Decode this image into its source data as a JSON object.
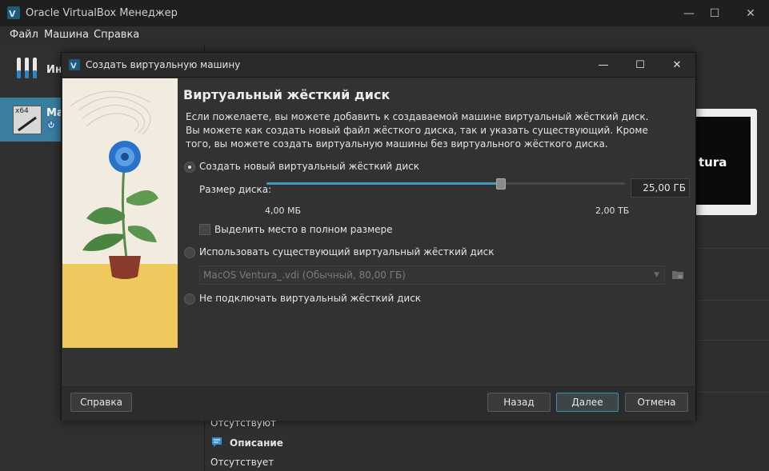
{
  "app": {
    "title": "Oracle VirtualBox Менеджер",
    "window_controls": {
      "minimize": "—",
      "maximize": "☐",
      "close": "✕"
    }
  },
  "menu": {
    "file": "Файл",
    "machine": "Машина",
    "help": "Справка"
  },
  "sidebar": {
    "tools_label": "Ин",
    "vm_name": "Ma",
    "vm_badge": "x64"
  },
  "preview": {
    "text": "tura"
  },
  "details": {
    "absent1": "Отсутствуют",
    "description_header": "Описание",
    "absent2": "Отсутствует"
  },
  "dialog": {
    "title": "Создать виртуальную машину",
    "heading": "Виртуальный жёсткий диск",
    "description": "Если пожелаете, вы можете добавить к создаваемой машине виртуальный жёсткий диск. Вы можете как создать новый файл жёсткого диска, так и указать существующий. Кроме того, вы можете создать виртуальную машины без виртуального жёсткого диска.",
    "option_new": "Создать новый виртуальный жёсткий диск",
    "disk_size_label": "Размер диска:",
    "disk_size_value": "25,00 ГБ",
    "slider_min": "4,00 МБ",
    "slider_max": "2,00 ТБ",
    "slider_position": 0.65,
    "preallocate": "Выделить место в полном размере",
    "option_existing": "Использовать существующий виртуальный жёсткий диск",
    "existing_value": "MacOS Ventura_.vdi (Обычный, 80,00 ГБ)",
    "option_none": "Не подключать виртуальный жёсткий диск",
    "buttons": {
      "help": "Справка",
      "back": "Назад",
      "next": "Далее",
      "cancel": "Отмена"
    },
    "selected_option": "new"
  },
  "colors": {
    "accent": "#3f9ac0",
    "selection": "#3a7fa0",
    "background": "#2b2b2b"
  }
}
